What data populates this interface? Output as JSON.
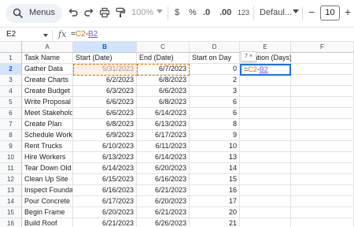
{
  "toolbar": {
    "menus_label": "Menus",
    "zoom": "100%",
    "currency": "$",
    "percent": "%",
    "decrease_decimal": ".0",
    "increase_decimal": ".00",
    "number_format": "123",
    "font": "Defaul...",
    "decrease_size": "−",
    "font_size": "10",
    "increase_size": "+"
  },
  "formula_bar": {
    "cell_ref": "E2",
    "fx": "fx",
    "formula_eq": "=",
    "formula_ref1": "C2",
    "formula_op": "-",
    "formula_ref2": "B2"
  },
  "columns": [
    "A",
    "B",
    "C",
    "D",
    "E",
    "F"
  ],
  "headers": [
    "Task Name",
    "Start (Date)",
    "End (Date)",
    "Start on Day",
    "Duration (Days)",
    ""
  ],
  "rows": [
    {
      "n": "1"
    },
    {
      "n": "2",
      "task": "Gather Data",
      "start": "5/31/2023",
      "end": "6/7/2023",
      "day": "0"
    },
    {
      "n": "3",
      "task": "Create Charts",
      "start": "6/2/2023",
      "end": "6/8/2023",
      "day": "2"
    },
    {
      "n": "4",
      "task": "Create Budget",
      "start": "6/3/2023",
      "end": "6/6/2023",
      "day": "3"
    },
    {
      "n": "5",
      "task": "Write Proposal",
      "start": "6/6/2023",
      "end": "6/8/2023",
      "day": "6"
    },
    {
      "n": "6",
      "task": "Meet Stakeholders",
      "start": "6/6/2023",
      "end": "6/14/2023",
      "day": "6"
    },
    {
      "n": "7",
      "task": "Create Plan",
      "start": "6/8/2023",
      "end": "6/13/2023",
      "day": "8"
    },
    {
      "n": "8",
      "task": "Schedule Work",
      "start": "6/9/2023",
      "end": "6/17/2023",
      "day": "9"
    },
    {
      "n": "9",
      "task": "Rent Trucks",
      "start": "6/10/2023",
      "end": "6/11/2023",
      "day": "10"
    },
    {
      "n": "10",
      "task": "Hire Workers",
      "start": "6/13/2023",
      "end": "6/14/2023",
      "day": "13"
    },
    {
      "n": "11",
      "task": "Tear Down Old Building",
      "start": "6/14/2023",
      "end": "6/20/2023",
      "day": "14"
    },
    {
      "n": "12",
      "task": "Clean Up Site",
      "start": "6/15/2023",
      "end": "6/16/2023",
      "day": "15"
    },
    {
      "n": "13",
      "task": "Inspect Foundation",
      "start": "6/16/2023",
      "end": "6/21/2023",
      "day": "16"
    },
    {
      "n": "14",
      "task": "Pour Concrete",
      "start": "6/17/2023",
      "end": "6/20/2023",
      "day": "17"
    },
    {
      "n": "15",
      "task": "Begin Frame",
      "start": "6/20/2023",
      "end": "6/21/2023",
      "day": "20"
    },
    {
      "n": "16",
      "task": "Build Roof",
      "start": "6/21/2023",
      "end": "6/26/2023",
      "day": "21"
    }
  ],
  "editor": {
    "tooltip": "7 ×",
    "eq": "=",
    "ref1": "C2",
    "op": "-",
    "ref2": "B2"
  }
}
